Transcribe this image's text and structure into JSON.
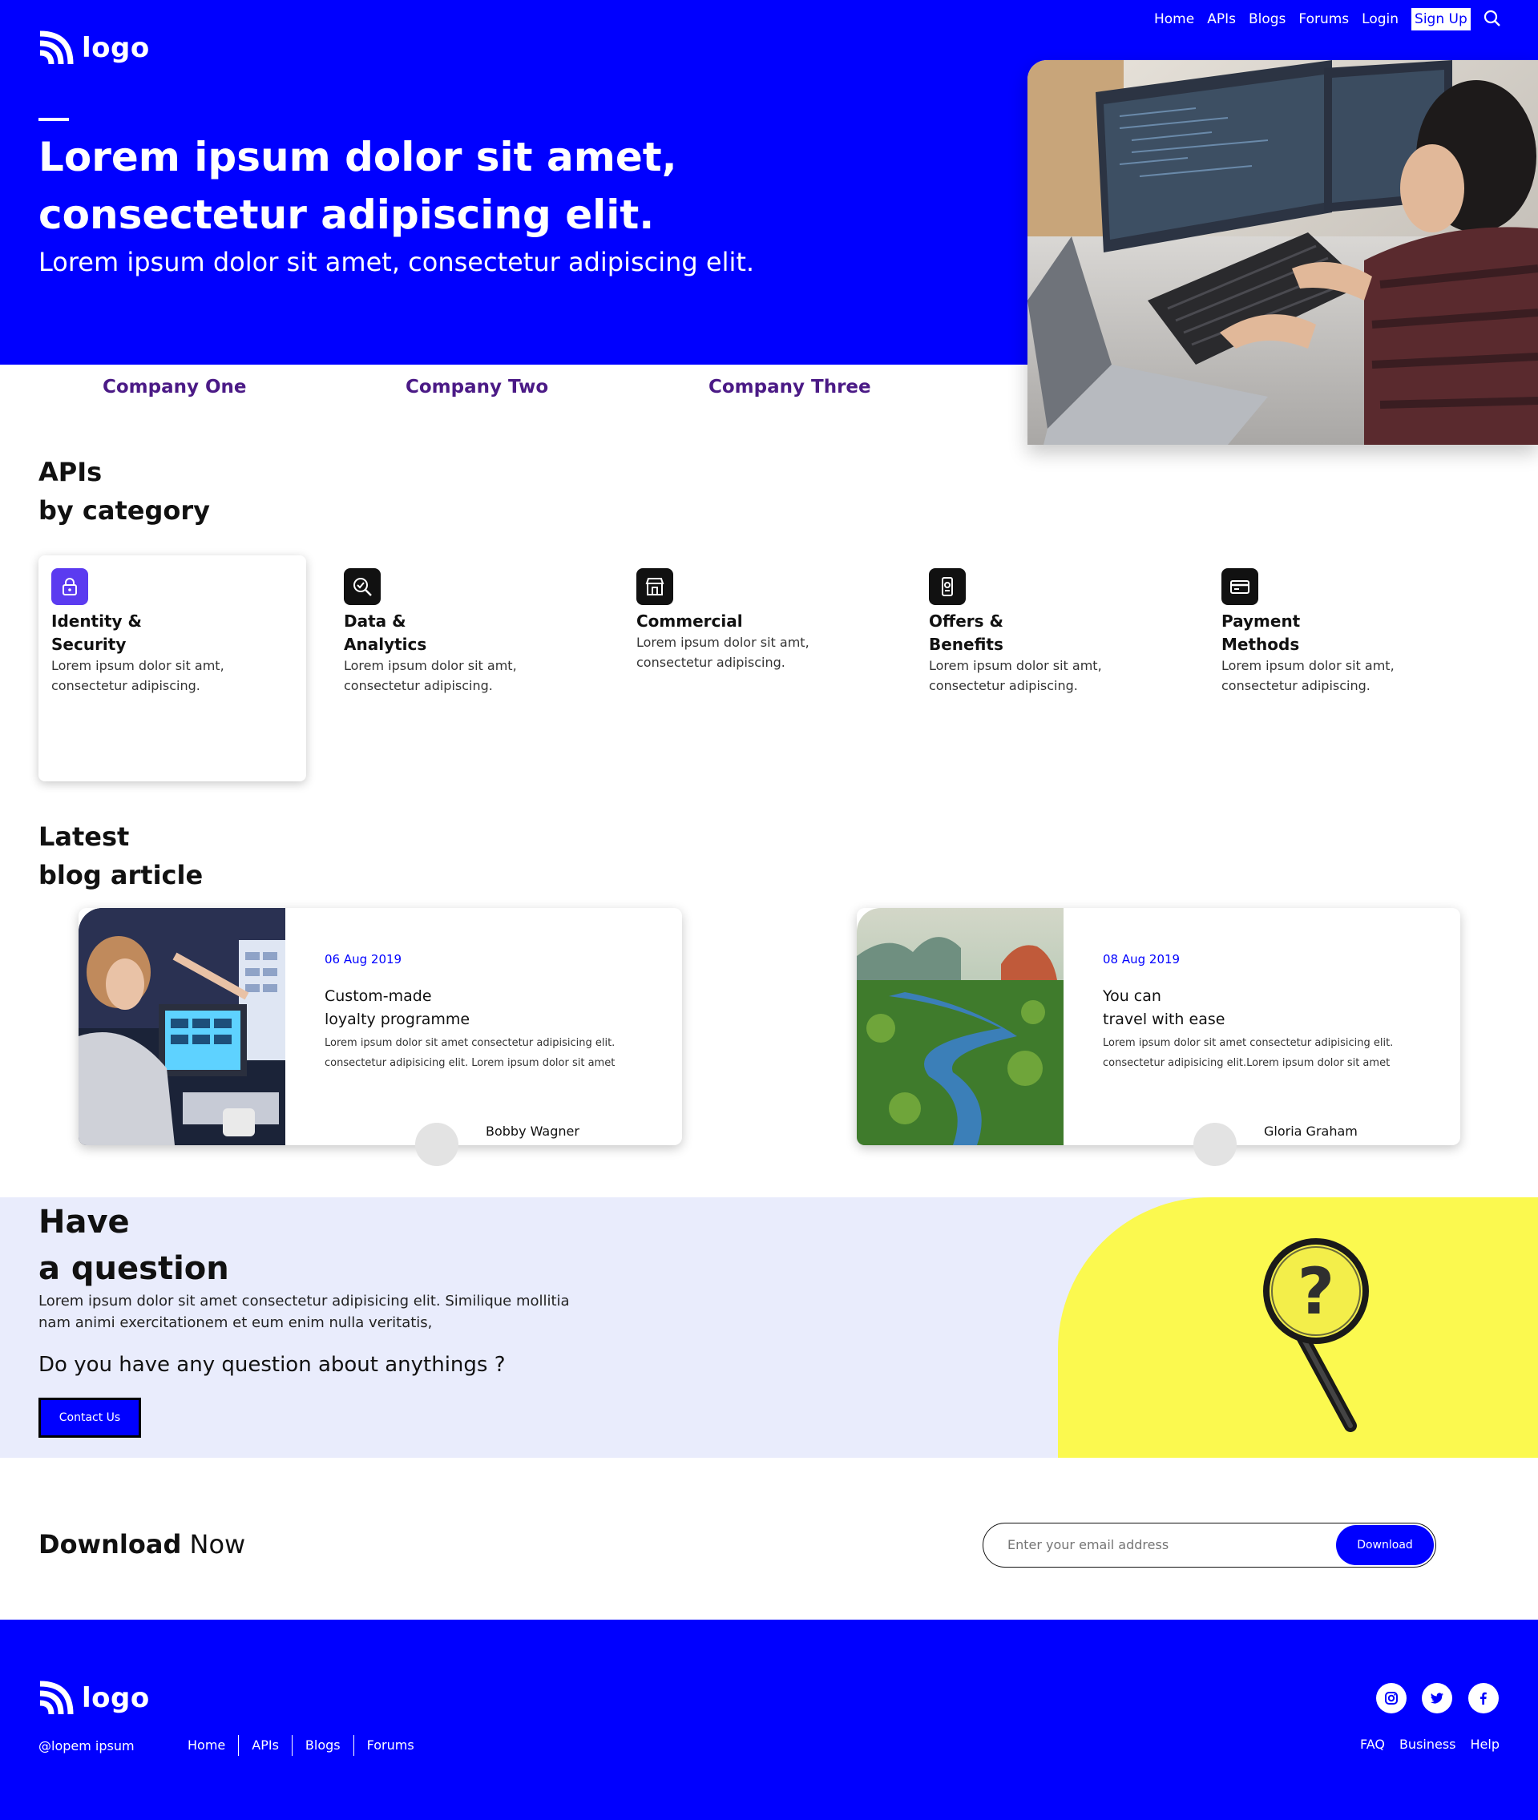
{
  "header": {
    "logo_text": "logo",
    "nav": [
      "Home",
      "APIs",
      "Blogs",
      "Forums",
      "Login"
    ],
    "signup_label": "Sign Up"
  },
  "hero": {
    "title": "Lorem ipsum dolor sit amet, consectetur adipiscing elit.",
    "subtitle": "Lorem ipsum dolor sit amet, consectetur adipiscing elit."
  },
  "companies": [
    "Company One",
    "Company Two",
    "Company Three"
  ],
  "apis": {
    "heading_line1": "APIs",
    "heading_line2": "by category",
    "categories": [
      {
        "name": "Identity &\nSecurity",
        "desc": "Lorem ipsum dolor sit amt, consectetur adipiscing.",
        "icon": "lock-icon"
      },
      {
        "name": "Data &\nAnalytics",
        "desc": "Lorem ipsum dolor sit amt, consectetur adipiscing.",
        "icon": "analytics-icon"
      },
      {
        "name": "Commercial",
        "desc": "Lorem ipsum dolor sit amt, consectetur adipiscing.",
        "icon": "store-icon"
      },
      {
        "name": "Offers &\nBenefits",
        "desc": "Lorem ipsum dolor sit amt, consectetur adipiscing.",
        "icon": "offers-icon"
      },
      {
        "name": "Payment\nMethods",
        "desc": "Lorem ipsum dolor sit amt, consectetur adipiscing.",
        "icon": "card-icon"
      }
    ]
  },
  "blog": {
    "heading_line1": "Latest",
    "heading_line2": "blog article",
    "articles": [
      {
        "date": "06 Aug 2019",
        "title": "Custom-made\nloyalty programme",
        "text": "Lorem ipsum dolor sit amet consectetur adipisicing elit. consectetur adipisicing elit. Lorem ipsum dolor sit amet",
        "author": "Bobby Wagner"
      },
      {
        "date": "08 Aug 2019",
        "title": "You can\ntravel with ease",
        "text": "Lorem ipsum dolor sit amet consectetur adipisicing elit. consectetur adipisicing elit.Lorem ipsum dolor sit amet",
        "author": "Gloria Graham"
      }
    ]
  },
  "question": {
    "heading_line1": "Have",
    "heading_line2": "a question",
    "text": "Lorem ipsum dolor sit amet consectetur adipisicing elit. Similique mollitia nam animi exercitationem et eum enim nulla veritatis,",
    "ask": "Do you have any question about anythings ?",
    "button": "Contact Us"
  },
  "download": {
    "title_bold": "Download",
    "title_rest": " Now",
    "placeholder": "Enter your email address",
    "button": "Download"
  },
  "footer": {
    "logo_text": "logo",
    "copyright": "@lopem ipsum",
    "links": [
      "Home",
      "APIs",
      "Blogs",
      "Forums"
    ],
    "right_links": [
      "FAQ",
      "Business",
      "Help"
    ]
  },
  "colors": {
    "primary": "#0000ff",
    "company_text": "#4b1a86",
    "question_bg": "#e9ecfc",
    "question_yellow": "#fbf94f",
    "active_icon": "#5b3bf0"
  }
}
